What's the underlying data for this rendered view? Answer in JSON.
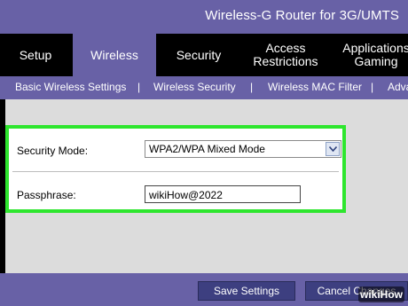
{
  "header": {
    "title": "Wireless-G Router for 3G/UMTS"
  },
  "tabs": [
    {
      "label": "Setup",
      "active": false
    },
    {
      "label": "Wireless",
      "active": true
    },
    {
      "label": "Security",
      "active": false
    },
    {
      "label": "Access Restrictions",
      "active": false
    },
    {
      "label": "Applications Gaming",
      "active": false
    }
  ],
  "subnav": {
    "items": [
      "Basic Wireless Settings",
      "Wireless Security",
      "Wireless MAC Filter",
      "Adva"
    ],
    "separator": "|"
  },
  "form": {
    "security_mode_label": "Security Mode:",
    "security_mode_value": "WPA2/WPA Mixed Mode",
    "passphrase_label": "Passphrase:",
    "passphrase_value": "wikiHow@2022"
  },
  "footer": {
    "save_label": "Save Settings",
    "cancel_label": "Cancel Changes"
  },
  "watermark": "wikiHow",
  "colors": {
    "brand_purple": "#6861a6",
    "highlight_green": "#2ee62e",
    "button_navy": "#3d3f80"
  }
}
